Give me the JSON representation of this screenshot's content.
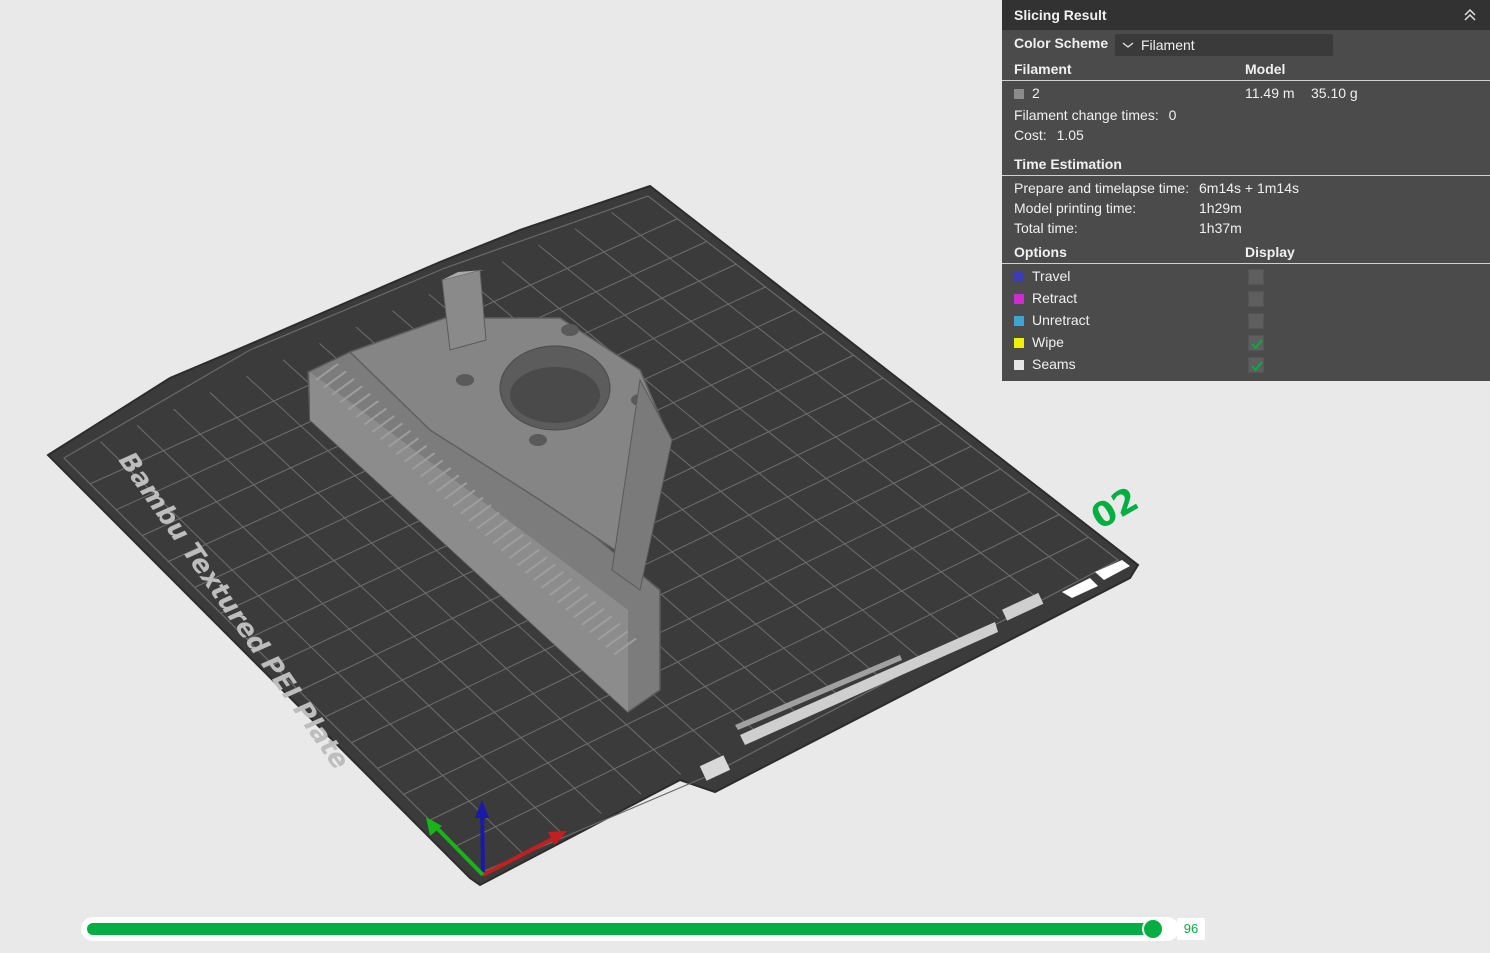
{
  "plate": {
    "label": "Bambu Textured PEI Plate",
    "plate_number": "02"
  },
  "panel": {
    "title": "Slicing Result",
    "color_scheme_label": "Color Scheme",
    "color_scheme_value": "Filament",
    "filament_header": "Filament",
    "model_header": "Model",
    "filament": {
      "id": "2",
      "length": "11.49 m",
      "weight": "35.10 g",
      "swatch_color": "#8c8c8c"
    },
    "change_times_label": "Filament change times:",
    "change_times_value": "0",
    "cost_label": "Cost:",
    "cost_value": "1.05",
    "time_header": "Time Estimation",
    "prepare_label": "Prepare and timelapse time:",
    "prepare_value": "6m14s + 1m14s",
    "model_time_label": "Model printing time:",
    "model_time_value": "1h29m",
    "total_label": "Total time:",
    "total_value": "1h37m",
    "options_header": "Options",
    "display_header": "Display",
    "options": [
      {
        "label": "Travel",
        "color": "#3c3cb4",
        "checked": false
      },
      {
        "label": "Retract",
        "color": "#d22ad2",
        "checked": false
      },
      {
        "label": "Unretract",
        "color": "#3ca6d2",
        "checked": false
      },
      {
        "label": "Wipe",
        "color": "#f0f000",
        "checked": true
      },
      {
        "label": "Seams",
        "color": "#e6e6e6",
        "checked": true
      }
    ]
  },
  "layer_slider": {
    "value": "96",
    "fraction": 1.0
  },
  "colors": {
    "accent": "#00ae42",
    "plate": "#3a3a3a",
    "model": "#8a8a8a"
  }
}
